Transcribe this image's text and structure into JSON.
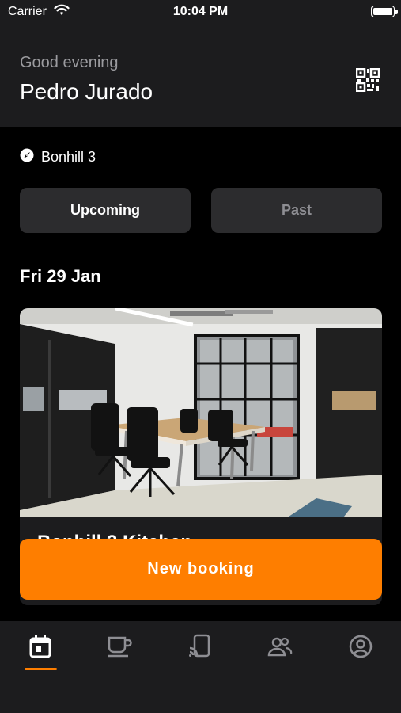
{
  "status_bar": {
    "carrier": "Carrier",
    "time": "10:04 PM"
  },
  "header": {
    "greeting": "Good evening",
    "user_name": "Pedro Jurado",
    "qr_icon": "qr-code-icon"
  },
  "location": {
    "icon": "compass-icon",
    "name": "Bonhill 3"
  },
  "tabs": [
    {
      "label": "Upcoming",
      "selected": true
    },
    {
      "label": "Past",
      "selected": false
    }
  ],
  "bookings": {
    "date_heading": "Fri 29 Jan",
    "card": {
      "title": "Bonhill 3 Kitchen"
    }
  },
  "actions": {
    "new_booking_label": "New booking"
  },
  "tab_bar": {
    "items": [
      {
        "icon": "calendar-icon",
        "selected": true
      },
      {
        "icon": "coffee-cup-icon",
        "selected": false
      },
      {
        "icon": "cast-device-icon",
        "selected": false
      },
      {
        "icon": "people-icon",
        "selected": false
      },
      {
        "icon": "profile-icon",
        "selected": false
      }
    ]
  },
  "colors": {
    "accent": "#fe7e00",
    "background": "#000000",
    "surface": "#1c1c1e",
    "button": "#2c2c2e"
  }
}
